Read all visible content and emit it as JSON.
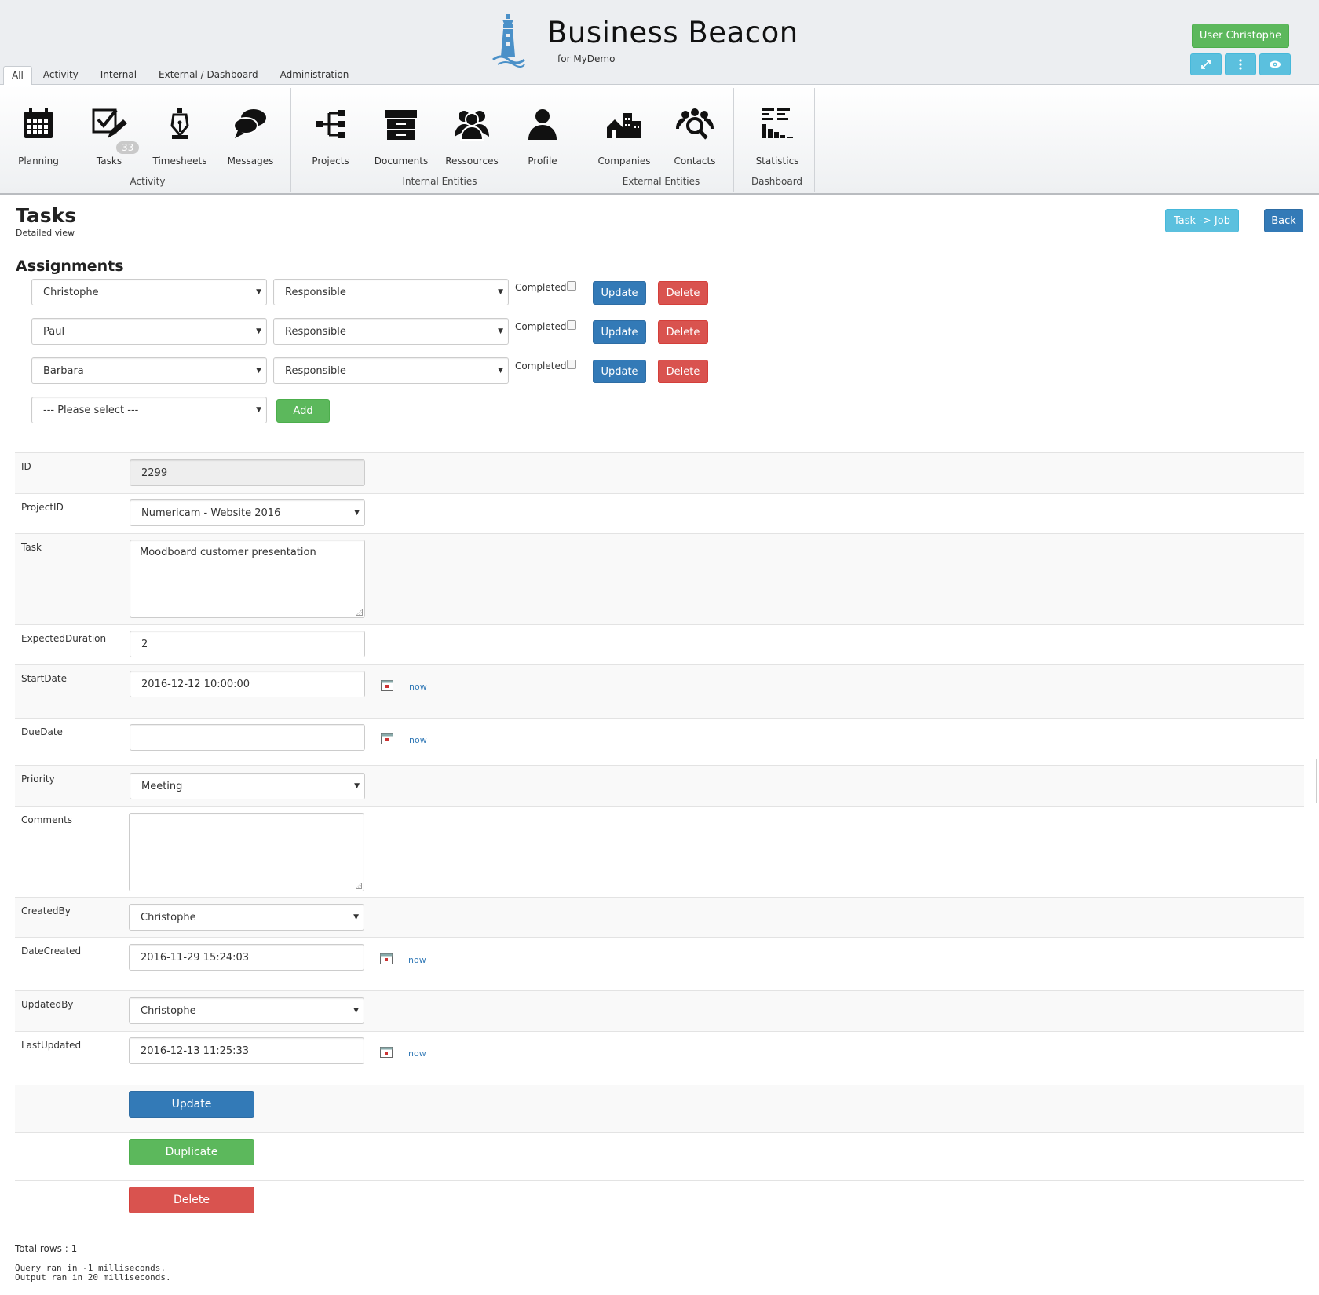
{
  "app": {
    "title": "Business Beacon",
    "subtitle": "for MyDemo",
    "user_button": "User Christophe"
  },
  "header_icons": [
    "expand-icon",
    "more-vertical-icon",
    "eye-icon"
  ],
  "tabs": [
    {
      "label": "All",
      "active": true
    },
    {
      "label": "Activity"
    },
    {
      "label": "Internal"
    },
    {
      "label": "External / Dashboard"
    },
    {
      "label": "Administration"
    }
  ],
  "ribbon": {
    "groups": [
      {
        "label": "Activity",
        "items": [
          {
            "label": "Planning",
            "icon": "calendar-icon"
          },
          {
            "label": "Tasks",
            "icon": "task-check-icon",
            "badge": "33"
          },
          {
            "label": "Timesheets",
            "icon": "pen-nib-icon"
          },
          {
            "label": "Messages",
            "icon": "chat-bubbles-icon"
          }
        ]
      },
      {
        "label": "Internal Entities",
        "items": [
          {
            "label": "Projects",
            "icon": "project-tree-icon"
          },
          {
            "label": "Documents",
            "icon": "archive-icon"
          },
          {
            "label": "Ressources",
            "icon": "users-icon"
          },
          {
            "label": "Profile",
            "icon": "user-icon"
          }
        ]
      },
      {
        "label": "External Entities",
        "items": [
          {
            "label": "Companies",
            "icon": "buildings-icon"
          },
          {
            "label": "Contacts",
            "icon": "contacts-search-icon"
          }
        ]
      },
      {
        "label": "Dashboard",
        "items": [
          {
            "label": "Statistics",
            "icon": "statistics-icon"
          }
        ]
      }
    ]
  },
  "page": {
    "title": "Tasks",
    "subtitle": "Detailed view",
    "task_job_button": "Task -> Job",
    "back_button": "Back"
  },
  "assignments": {
    "title": "Assignments",
    "rows": [
      {
        "person": "Christophe",
        "role": "Responsible",
        "completed_label": "Completed",
        "completed": false,
        "update": "Update",
        "delete": "Delete"
      },
      {
        "person": "Paul",
        "role": "Responsible",
        "completed_label": "Completed",
        "completed": false,
        "update": "Update",
        "delete": "Delete"
      },
      {
        "person": "Barbara",
        "role": "Responsible",
        "completed_label": "Completed",
        "completed": false,
        "update": "Update",
        "delete": "Delete"
      }
    ],
    "new_select": "--- Please select ---",
    "add_button": "Add"
  },
  "form": {
    "id_label": "ID",
    "id_value": "2299",
    "project_label": "ProjectID",
    "project_value": "Numericam - Website 2016",
    "task_label": "Task",
    "task_value": "Moodboard customer presentation",
    "duration_label": "ExpectedDuration",
    "duration_value": "2",
    "start_label": "StartDate",
    "start_value": "2016-12-12 10:00:00",
    "due_label": "DueDate",
    "due_value": "",
    "priority_label": "Priority",
    "priority_value": "Meeting",
    "comments_label": "Comments",
    "comments_value": "",
    "createdby_label": "CreatedBy",
    "createdby_value": "Christophe",
    "datecreated_label": "DateCreated",
    "datecreated_value": "2016-11-29 15:24:03",
    "updatedby_label": "UpdatedBy",
    "updatedby_value": "Christophe",
    "lastupdated_label": "LastUpdated",
    "lastupdated_value": "2016-12-13 11:25:33",
    "now_link": "now",
    "update_button": "Update",
    "duplicate_button": "Duplicate",
    "delete_button": "Delete"
  },
  "footer": {
    "total_rows": "Total rows : 1",
    "query_time": "Query ran in -1 milliseconds.",
    "output_time": "Output ran in 20 milliseconds."
  }
}
